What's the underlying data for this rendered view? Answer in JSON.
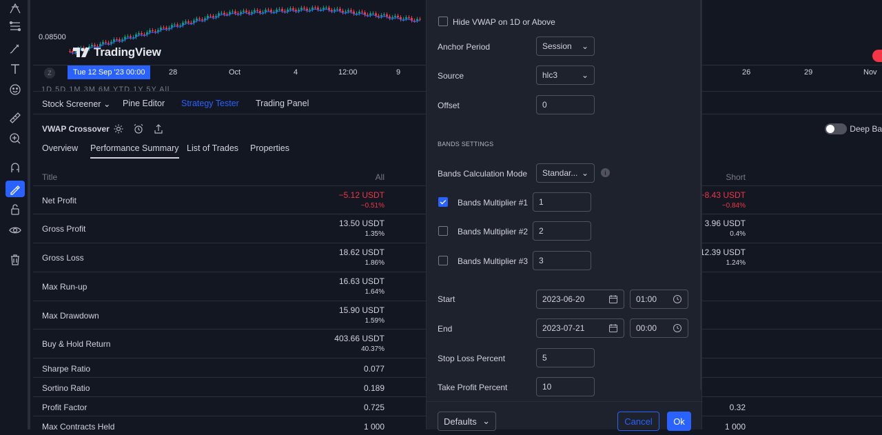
{
  "chart": {
    "price_label": "0.08500",
    "logo_text": "TradingView",
    "current_date": "Tue 12 Sep '23  00:00",
    "tz": "Z",
    "time_labels": [
      "28",
      "Oct",
      "4",
      "12:00",
      "9",
      "26",
      "29",
      "Nov"
    ],
    "ranges": "1D  5D  1M  3M  6M  YTD  1Y  5Y  All"
  },
  "tabs": {
    "stock_screener": "Stock Screener",
    "pine_editor": "Pine Editor",
    "strategy_tester": "Strategy Tester",
    "trading_panel": "Trading Panel"
  },
  "strategy": {
    "name": "VWAP Crossover",
    "deep_backtest": "Deep Ba"
  },
  "subtabs": {
    "overview": "Overview",
    "performance": "Performance Summary",
    "trades": "List of Trades",
    "properties": "Properties"
  },
  "perf": {
    "headers": {
      "title": "Title",
      "all": "All",
      "short": "Short"
    },
    "rows": [
      {
        "title": "Net Profit",
        "all": "−5.12 USDT",
        "all_pct": "−0.51%",
        "short": "−8.43 USDT",
        "short_pct": "−0.84%"
      },
      {
        "title": "Gross Profit",
        "all": "13.50 USDT",
        "all_pct": "1.35%",
        "short": "3.96 USDT",
        "short_pct": "0.4%"
      },
      {
        "title": "Gross Loss",
        "all": "18.62 USDT",
        "all_pct": "1.86%",
        "short": "12.39 USDT",
        "short_pct": "1.24%"
      },
      {
        "title": "Max Run-up",
        "all": "16.63 USDT",
        "all_pct": "1.64%",
        "short": "",
        "short_pct": ""
      },
      {
        "title": "Max Drawdown",
        "all": "15.90 USDT",
        "all_pct": "1.59%",
        "short": "",
        "short_pct": ""
      },
      {
        "title": "Buy & Hold Return",
        "all": "403.66 USDT",
        "all_pct": "40.37%",
        "short": "",
        "short_pct": ""
      },
      {
        "title": "Sharpe Ratio",
        "all": "0.077",
        "all_pct": "",
        "short": "",
        "short_pct": ""
      },
      {
        "title": "Sortino Ratio",
        "all": "0.189",
        "all_pct": "",
        "short": "",
        "short_pct": ""
      },
      {
        "title": "Profit Factor",
        "all": "0.725",
        "all_pct": "",
        "short": "0.32",
        "short_pct": ""
      },
      {
        "title": "Max Contracts Held",
        "all": "1 000",
        "all_pct": "",
        "short": "1 000",
        "short_pct": ""
      }
    ]
  },
  "dialog": {
    "hide_vwap": "Hide VWAP on 1D or Above",
    "anchor_label": "Anchor Period",
    "anchor_value": "Session",
    "source_label": "Source",
    "source_value": "hlc3",
    "offset_label": "Offset",
    "offset_value": "0",
    "bands_section": "BANDS SETTINGS",
    "bands_mode_label": "Bands Calculation Mode",
    "bands_mode_value": "Standar...",
    "mult1_label": "Bands Multiplier #1",
    "mult1_value": "1",
    "mult1_checked": true,
    "mult2_label": "Bands Multiplier #2",
    "mult2_value": "2",
    "mult2_checked": false,
    "mult3_label": "Bands Multiplier #3",
    "mult3_value": "3",
    "mult3_checked": false,
    "start_label": "Start",
    "start_date": "2023-06-20",
    "start_time": "01:00",
    "end_label": "End",
    "end_date": "2023-07-21",
    "end_time": "00:00",
    "sl_label": "Stop Loss Percent",
    "sl_value": "5",
    "tp_label": "Take Profit Percent",
    "tp_value": "10",
    "defaults": "Defaults",
    "cancel": "Cancel",
    "ok": "Ok"
  },
  "colors": {
    "accent": "#2962ff",
    "negative": "#f23645",
    "up": "#089981",
    "bg": "#131722",
    "panel": "#1e222d"
  }
}
